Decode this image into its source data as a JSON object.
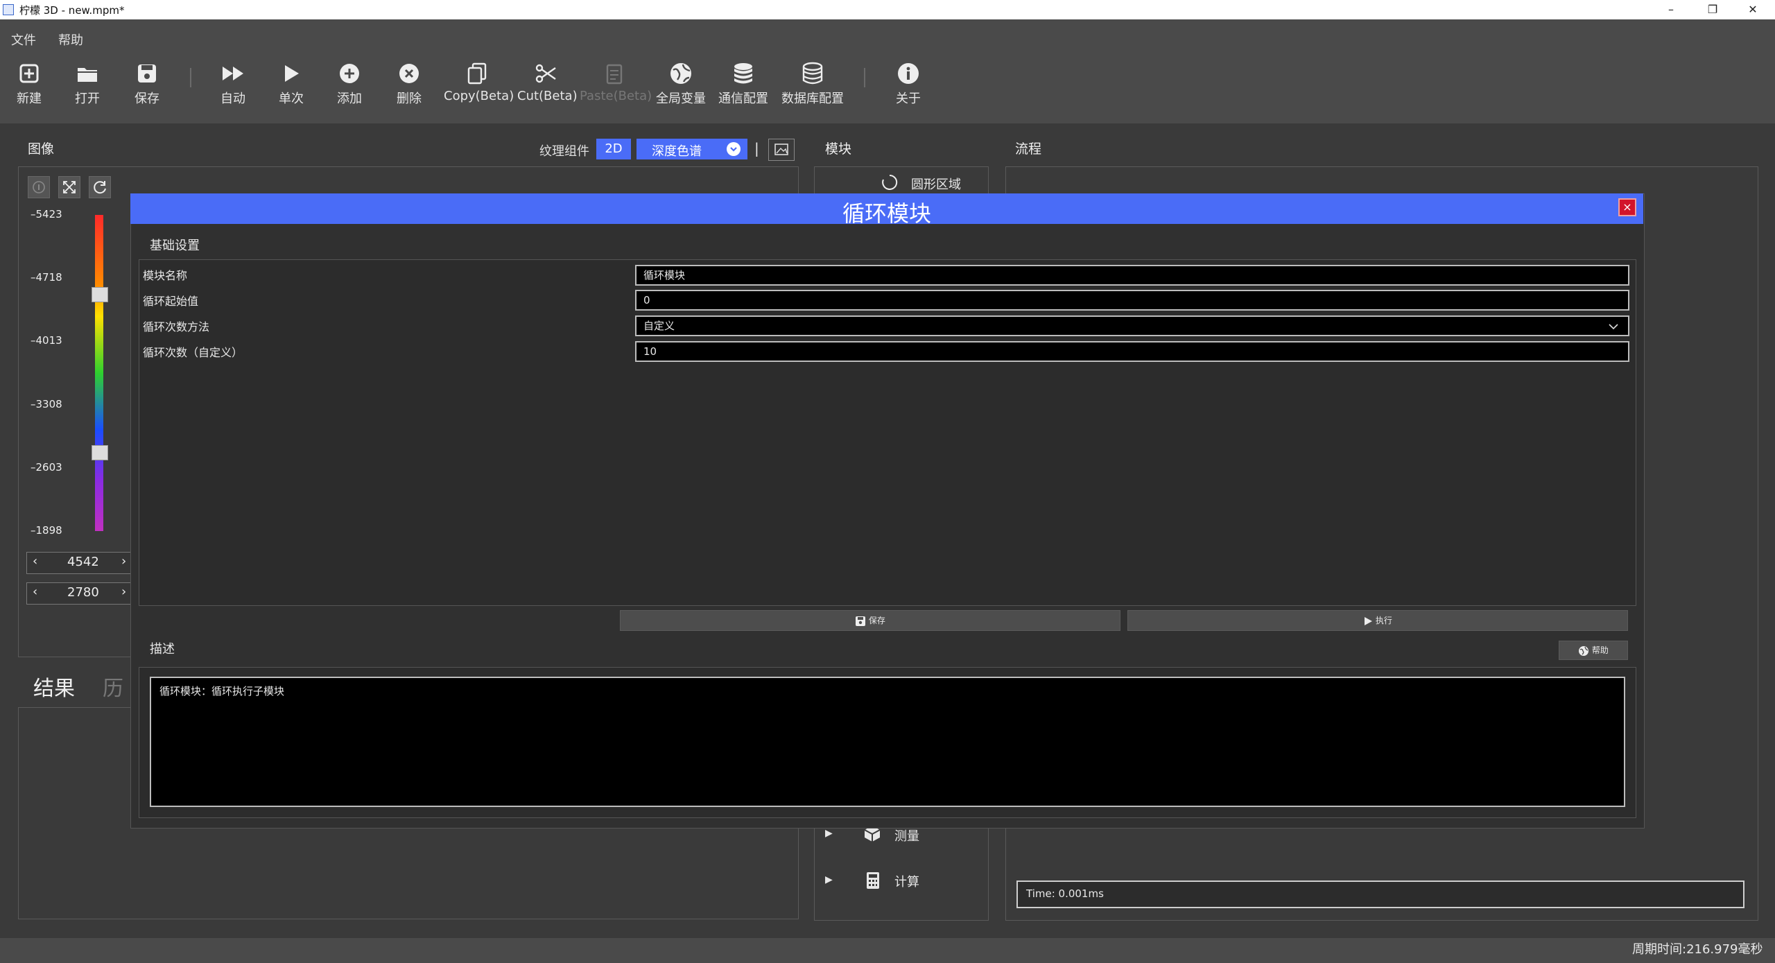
{
  "window": {
    "title": "柠檬 3D  - new.mpm*"
  },
  "menu": [
    "文件",
    "帮助"
  ],
  "toolbar": [
    {
      "label": "新建",
      "icon": "new-file-icon"
    },
    {
      "label": "打开",
      "icon": "folder-open-icon"
    },
    {
      "label": "保存",
      "icon": "save-icon"
    },
    {
      "label": "自动",
      "icon": "fast-forward-icon"
    },
    {
      "label": "单次",
      "icon": "play-icon"
    },
    {
      "label": "添加",
      "icon": "plus-circle-icon"
    },
    {
      "label": "删除",
      "icon": "x-circle-icon"
    },
    {
      "label": "Copy(Beta)",
      "icon": "copy-icon"
    },
    {
      "label": "Cut(Beta)",
      "icon": "scissors-icon"
    },
    {
      "label": "Paste(Beta)",
      "icon": "paste-icon"
    },
    {
      "label": "全局变量",
      "icon": "globe-icon"
    },
    {
      "label": "通信配置",
      "icon": "database-icon"
    },
    {
      "label": "数据库配置",
      "icon": "database-outline-icon"
    },
    {
      "label": "关于",
      "icon": "info-icon"
    }
  ],
  "image_panel": {
    "title": "图像",
    "texture_label": "纹理组件",
    "mode_2d": "2D",
    "colormap": "深度色谱",
    "divider": "|",
    "scale_ticks": [
      "5423",
      "4718",
      "4013",
      "3308",
      "2603",
      "1898"
    ],
    "range_max": "4542",
    "range_min": "2780"
  },
  "results": {
    "tab_result": "结果",
    "tab_history": "历"
  },
  "module_panel": {
    "title": "模块",
    "items": [
      "圆形区域",
      "测量",
      "计算"
    ]
  },
  "flow_panel": {
    "title": "流程",
    "time": "Time: 0.001ms"
  },
  "dialog": {
    "title": "循环模块",
    "close": "×",
    "section_basic": "基础设置",
    "params": [
      {
        "label": "模块名称",
        "value": "循环模块"
      },
      {
        "label": "循环起始值",
        "value": "0"
      },
      {
        "label": "循环次数方法",
        "value": "自定义"
      },
      {
        "label": "循环次数（自定义）",
        "value": "10"
      }
    ],
    "save_label": "保存",
    "run_label": "执行",
    "section_desc": "描述",
    "help_label": "帮助",
    "description": "循环模块：循环执行子模块"
  },
  "status": {
    "cycle_time": "周期时间:216.979毫秒"
  }
}
